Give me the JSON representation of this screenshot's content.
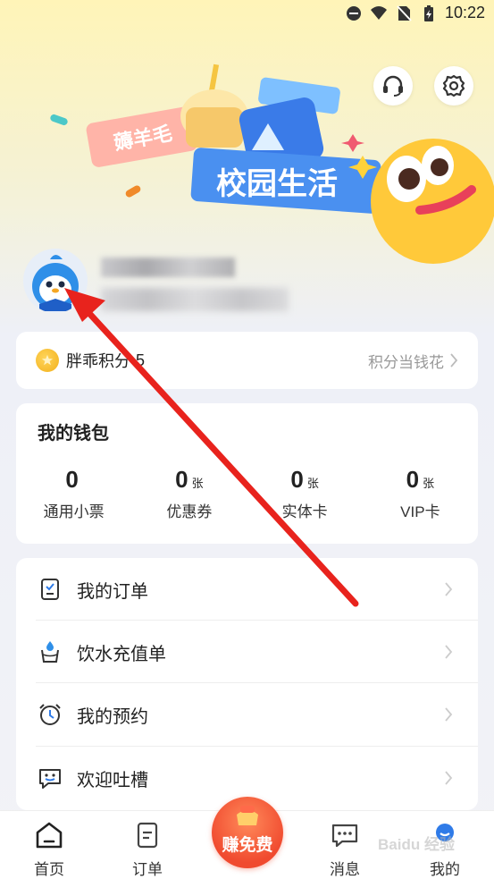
{
  "status_bar": {
    "time": "10:22"
  },
  "banner": {
    "tag": "薅羊毛",
    "title": "校园生活"
  },
  "points": {
    "label": "胖乖积分",
    "value": "5",
    "action": "积分当钱花"
  },
  "wallet": {
    "title": "我的钱包",
    "items": [
      {
        "value": "0",
        "unit": "",
        "label": "通用小票"
      },
      {
        "value": "0",
        "unit": "张",
        "label": "优惠券"
      },
      {
        "value": "0",
        "unit": "张",
        "label": "实体卡"
      },
      {
        "value": "0",
        "unit": "张",
        "label": "VIP卡"
      }
    ]
  },
  "menu": {
    "items": [
      {
        "label": "我的订单",
        "icon": "order-icon"
      },
      {
        "label": "饮水充值单",
        "icon": "water-cup-icon"
      },
      {
        "label": "我的预约",
        "icon": "alarm-clock-icon"
      },
      {
        "label": "欢迎吐槽",
        "icon": "feedback-icon"
      }
    ]
  },
  "bottom_nav": {
    "tabs": [
      {
        "label": "首页",
        "icon": "home-icon"
      },
      {
        "label": "订单",
        "icon": "order-tab-icon"
      },
      {
        "label": "消息",
        "icon": "message-icon"
      },
      {
        "label": "我的",
        "icon": "profile-icon"
      }
    ],
    "center": {
      "label": "赚免费",
      "icon": "money-bag-icon"
    }
  },
  "watermark": "Baidu 经验",
  "colors": {
    "accent": "#f04a2f",
    "annotation_arrow": "#e8231d",
    "banner_blue": "#4a90f0"
  }
}
